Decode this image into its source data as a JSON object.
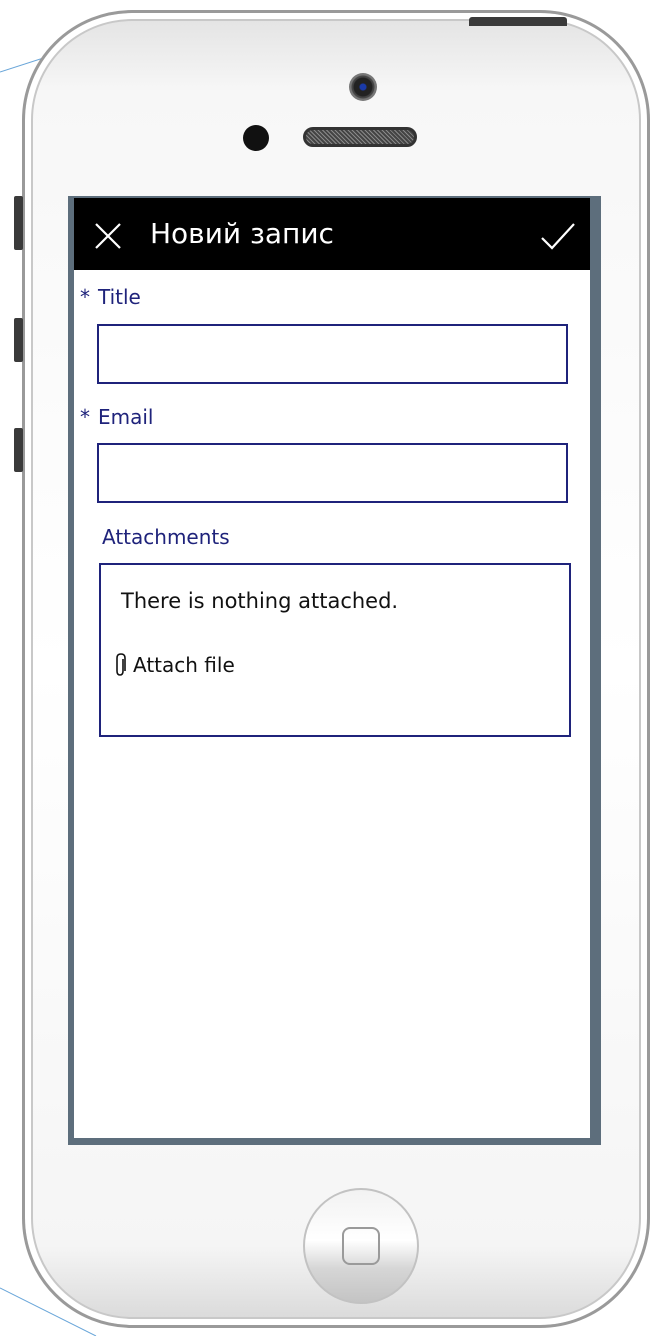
{
  "header": {
    "title": "Новий запис",
    "close_icon": "close-icon",
    "submit_icon": "checkmark-icon"
  },
  "form": {
    "title_field": {
      "required_marker": "*",
      "label": "Title",
      "value": ""
    },
    "email_field": {
      "required_marker": "*",
      "label": "Email",
      "value": ""
    },
    "attachments": {
      "label": "Attachments",
      "empty_text": "There is nothing attached.",
      "attach_label": "Attach file",
      "attach_icon": "paperclip-icon"
    }
  },
  "colors": {
    "header_bg": "#000000",
    "label_text": "#1f237b",
    "screen_frame": "#5d6e7c"
  }
}
